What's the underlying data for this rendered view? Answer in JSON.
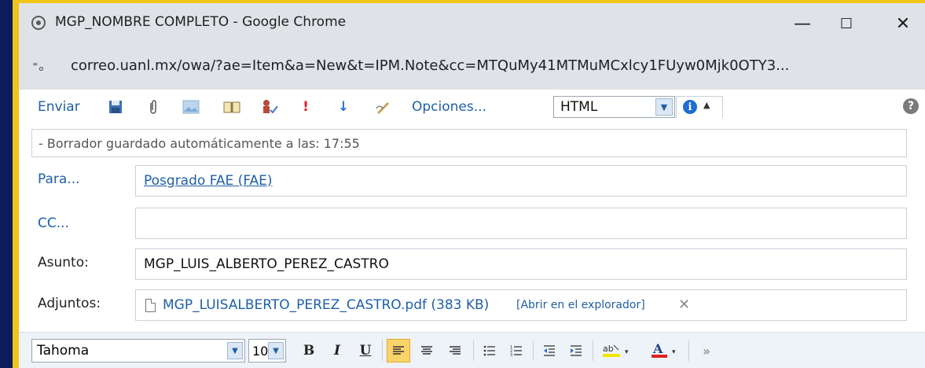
{
  "window": {
    "title": "MGP_NOMBRE COMPLETO - Google Chrome",
    "minimize": "—",
    "maximize": "☐",
    "close": "✕"
  },
  "address": {
    "site_icon": "⁼ₒ",
    "url": "correo.uanl.mx/owa/?ae=Item&a=New&t=IPM.Note&cc=MTQuMy41MTMuMCxlcy1FUyw0Mjk0OTY3..."
  },
  "toolbar": {
    "send_label": "Enviar",
    "options_label": "Opciones...",
    "format_value": "HTML",
    "help_glyph": "?",
    "info_glyph": "i"
  },
  "draft_note": "- Borrador guardado automáticamente a las: 17:55",
  "fields": {
    "to_label": "Para...",
    "to_value": "Posgrado FAE (FAE)",
    "cc_label": "CC...",
    "cc_value": "",
    "subject_label": "Asunto:",
    "subject_value": "MGP_LUIS_ALBERTO_PEREZ_CASTRO",
    "attach_label": "Adjuntos:",
    "attach_name": "MGP_LUISALBERTO_PEREZ_CASTRO.pdf",
    "attach_size": "(383 KB)",
    "attach_open": "[Abrir en el explorador]",
    "attach_remove": "✕"
  },
  "format": {
    "font": "Tahoma",
    "size": "10",
    "bold": "B",
    "italic": "I",
    "underline": "U",
    "more": "»"
  },
  "colors": {
    "link": "#1f5fa8",
    "background": "#0c1d5a",
    "frame": "#f0c419"
  }
}
